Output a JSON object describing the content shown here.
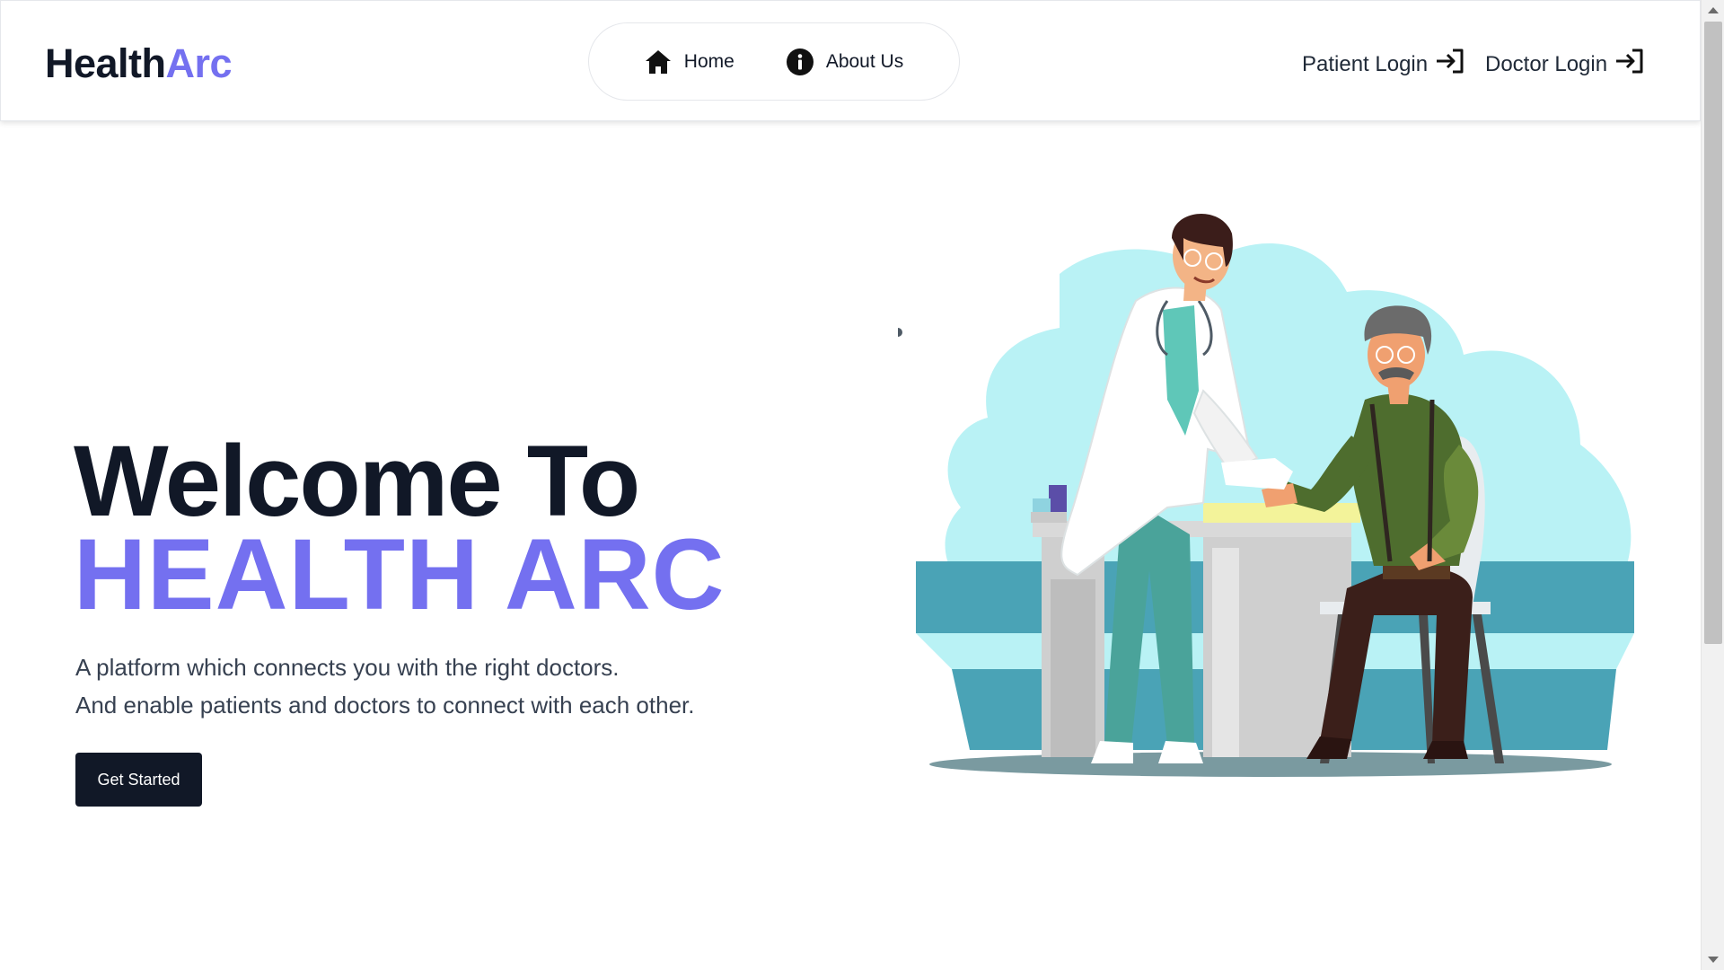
{
  "brand": {
    "name_part1": "Health",
    "name_part2": "Arc",
    "accent_color": "#7470f0"
  },
  "nav": {
    "home_label": "Home",
    "about_label": "About Us",
    "home_icon": "home-icon",
    "about_icon": "info-icon"
  },
  "auth": {
    "patient_login_label": "Patient Login",
    "doctor_login_label": "Doctor Login",
    "login_icon": "login-icon"
  },
  "hero": {
    "title_line1": "Welcome To",
    "title_line2": "HEALTH ARC",
    "subtitle_line1": "A platform which connects you with the right doctors.",
    "subtitle_line2": "And enable patients and doctors to connect with each other.",
    "cta_label": "Get Started"
  },
  "colors": {
    "dark": "#111827",
    "accent": "#7470f0",
    "bg_light": "#b9f2f5",
    "bg_teal": "#4aa3b6"
  }
}
